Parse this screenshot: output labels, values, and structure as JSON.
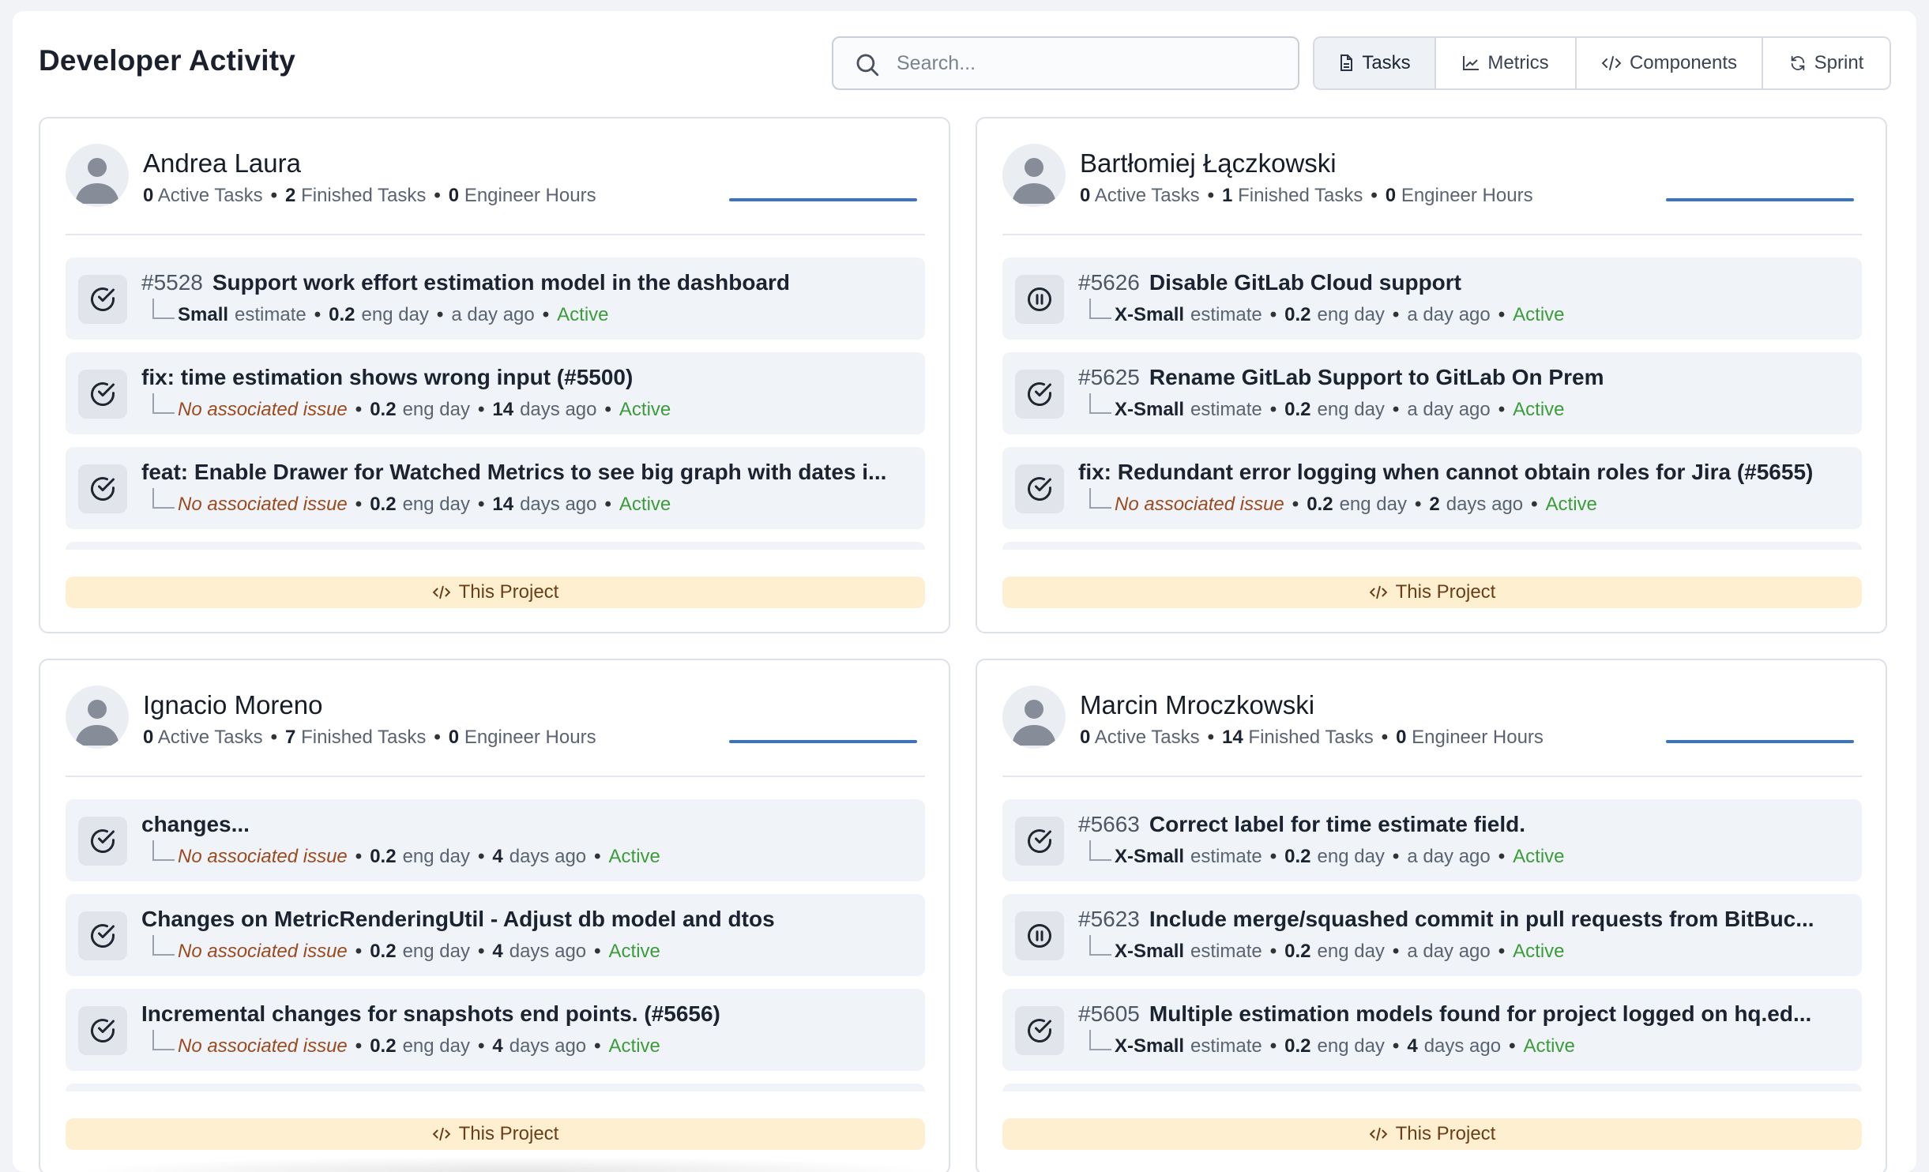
{
  "header": {
    "title": "Developer Activity",
    "search_placeholder": "Search...",
    "tabs": [
      {
        "label": "Tasks",
        "icon": "document-icon",
        "active": true
      },
      {
        "label": "Metrics",
        "icon": "line-chart-icon",
        "active": false
      },
      {
        "label": "Components",
        "icon": "code-icon",
        "active": false
      },
      {
        "label": "Sprint",
        "icon": "refresh-icon",
        "active": false
      }
    ]
  },
  "colors": {
    "accent_line": "#3b73c3",
    "status_active": "#3c9c3c",
    "no_issue": "#9a4a1e",
    "project_bg": "#fdefcf"
  },
  "developers": [
    {
      "name": "Andrea Laura",
      "active_tasks": "0",
      "active_label": "Active Tasks",
      "finished_tasks": "2",
      "finished_label": "Finished Tasks",
      "hours": "0",
      "hours_label": "Engineer Hours",
      "project_label": "This Project",
      "tasks": [
        {
          "status_icon": "check-circle-icon",
          "number": "#5528",
          "title": "Support work effort estimation model in the dashboard",
          "estimate": "Small",
          "estimate_label": "estimate",
          "no_issue": "",
          "eng": "0.2",
          "eng_label": "eng day",
          "age_num": "",
          "age": "a day ago",
          "status": "Active"
        },
        {
          "status_icon": "check-circle-icon",
          "number": "",
          "title": "fix: time estimation shows wrong input (#5500)",
          "estimate": "",
          "estimate_label": "",
          "no_issue": "No associated issue",
          "eng": "0.2",
          "eng_label": "eng day",
          "age_num": "14",
          "age": "days ago",
          "status": "Active"
        },
        {
          "status_icon": "check-circle-icon",
          "number": "",
          "title": "feat: Enable Drawer for Watched Metrics to see big graph with dates i...",
          "estimate": "",
          "estimate_label": "",
          "no_issue": "No associated issue",
          "eng": "0.2",
          "eng_label": "eng day",
          "age_num": "14",
          "age": "days ago",
          "status": "Active"
        }
      ]
    },
    {
      "name": "Bartłomiej Łączkowski",
      "active_tasks": "0",
      "active_label": "Active Tasks",
      "finished_tasks": "1",
      "finished_label": "Finished Tasks",
      "hours": "0",
      "hours_label": "Engineer Hours",
      "project_label": "This Project",
      "tasks": [
        {
          "status_icon": "pause-circle-icon",
          "number": "#5626",
          "title": "Disable GitLab Cloud support",
          "estimate": "X-Small",
          "estimate_label": "estimate",
          "no_issue": "",
          "eng": "0.2",
          "eng_label": "eng day",
          "age_num": "",
          "age": "a day ago",
          "status": "Active"
        },
        {
          "status_icon": "check-circle-icon",
          "number": "#5625",
          "title": "Rename GitLab Support to GitLab On Prem",
          "estimate": "X-Small",
          "estimate_label": "estimate",
          "no_issue": "",
          "eng": "0.2",
          "eng_label": "eng day",
          "age_num": "",
          "age": "a day ago",
          "status": "Active"
        },
        {
          "status_icon": "check-circle-icon",
          "number": "",
          "title": "fix: Redundant error logging when cannot obtain roles for Jira (#5655)",
          "estimate": "",
          "estimate_label": "",
          "no_issue": "No associated issue",
          "eng": "0.2",
          "eng_label": "eng day",
          "age_num": "2",
          "age": "days ago",
          "status": "Active"
        }
      ]
    },
    {
      "name": "Ignacio Moreno",
      "active_tasks": "0",
      "active_label": "Active Tasks",
      "finished_tasks": "7",
      "finished_label": "Finished Tasks",
      "hours": "0",
      "hours_label": "Engineer Hours",
      "project_label": "This Project",
      "tasks": [
        {
          "status_icon": "check-circle-icon",
          "number": "",
          "title": "changes...",
          "estimate": "",
          "estimate_label": "",
          "no_issue": "No associated issue",
          "eng": "0.2",
          "eng_label": "eng day",
          "age_num": "4",
          "age": "days ago",
          "status": "Active"
        },
        {
          "status_icon": "check-circle-icon",
          "number": "",
          "title": "Changes on MetricRenderingUtil - Adjust db model and dtos",
          "estimate": "",
          "estimate_label": "",
          "no_issue": "No associated issue",
          "eng": "0.2",
          "eng_label": "eng day",
          "age_num": "4",
          "age": "days ago",
          "status": "Active"
        },
        {
          "status_icon": "check-circle-icon",
          "number": "",
          "title": "Incremental changes for snapshots end points. (#5656)",
          "estimate": "",
          "estimate_label": "",
          "no_issue": "No associated issue",
          "eng": "0.2",
          "eng_label": "eng day",
          "age_num": "4",
          "age": "days ago",
          "status": "Active"
        }
      ]
    },
    {
      "name": "Marcin Mroczkowski",
      "active_tasks": "0",
      "active_label": "Active Tasks",
      "finished_tasks": "14",
      "finished_label": "Finished Tasks",
      "hours": "0",
      "hours_label": "Engineer Hours",
      "project_label": "This Project",
      "tasks": [
        {
          "status_icon": "check-circle-icon",
          "number": "#5663",
          "title": "Correct label for time estimate field.",
          "estimate": "X-Small",
          "estimate_label": "estimate",
          "no_issue": "",
          "eng": "0.2",
          "eng_label": "eng day",
          "age_num": "",
          "age": "a day ago",
          "status": "Active"
        },
        {
          "status_icon": "pause-circle-icon",
          "number": "#5623",
          "title": "Include merge/squashed commit in pull requests from BitBuc...",
          "estimate": "X-Small",
          "estimate_label": "estimate",
          "no_issue": "",
          "eng": "0.2",
          "eng_label": "eng day",
          "age_num": "",
          "age": "a day ago",
          "status": "Active"
        },
        {
          "status_icon": "check-circle-icon",
          "number": "#5605",
          "title": "Multiple estimation models found for project logged on hq.ed...",
          "estimate": "X-Small",
          "estimate_label": "estimate",
          "no_issue": "",
          "eng": "0.2",
          "eng_label": "eng day",
          "age_num": "4",
          "age": "days ago",
          "status": "Active"
        }
      ]
    }
  ]
}
